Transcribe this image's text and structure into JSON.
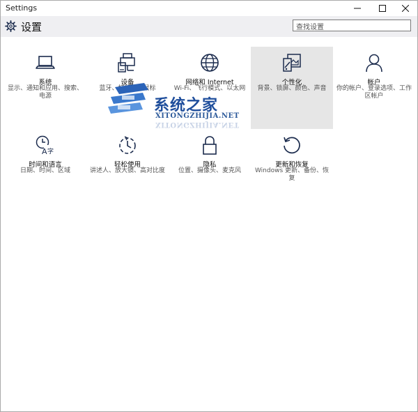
{
  "window": {
    "title": "Settings"
  },
  "header": {
    "title": "设置",
    "search_placeholder": "查找设置"
  },
  "tiles": [
    {
      "name": "系统",
      "desc": "显示、通知和应用、搜索、电源",
      "icon": "laptop-icon"
    },
    {
      "name": "设备",
      "desc": "蓝牙、打印机、鼠标",
      "icon": "devices-icon"
    },
    {
      "name": "网络和 Internet",
      "desc": "Wi-Fi、飞行模式、以太网",
      "icon": "globe-icon"
    },
    {
      "name": "个性化",
      "desc": "背景、锁屏、颜色、声音",
      "icon": "personalization-icon"
    },
    {
      "name": "帐户",
      "desc": "你的帐户、登录选项、工作区帐户",
      "icon": "person-icon"
    },
    {
      "name": "时间和语言",
      "desc": "日期、时间、区域",
      "icon": "time-language-icon"
    },
    {
      "name": "轻松使用",
      "desc": "讲述人、放大镜、高对比度",
      "icon": "ease-of-access-icon"
    },
    {
      "name": "隐私",
      "desc": "位置、摄像头、麦克风",
      "icon": "lock-icon"
    },
    {
      "name": "更新和恢复",
      "desc": "Windows 更新、备份、恢复",
      "icon": "update-icon"
    }
  ],
  "watermark": {
    "cn": "系统之家",
    "en": "XITONGZHIJIA.NET"
  },
  "colors": {
    "icon": "#1b2b4d",
    "selected_tile": "#e6e6e6",
    "header_bg": "#efeff2",
    "watermark_blue": "#1f4e9c"
  }
}
